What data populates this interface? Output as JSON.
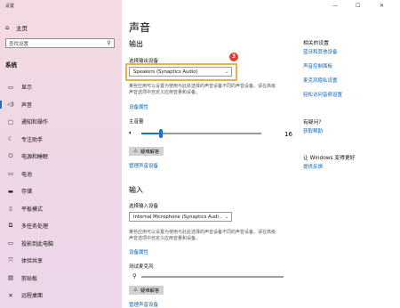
{
  "window": {
    "title": "设置",
    "minimize": "—",
    "maximize": "☐",
    "close": "✕"
  },
  "sidebar": {
    "home_label": "主页",
    "search_placeholder": "查找设置",
    "section_label": "系统",
    "items": [
      {
        "label": "显示",
        "icon": "monitor-icon",
        "glyph": "▭"
      },
      {
        "label": "声音",
        "icon": "speaker-icon",
        "glyph": "◁)",
        "selected": true
      },
      {
        "label": "通知和操作",
        "icon": "notification-icon",
        "glyph": "▢"
      },
      {
        "label": "专注助手",
        "icon": "moon-icon",
        "glyph": "☾"
      },
      {
        "label": "电源和睡眠",
        "icon": "power-icon",
        "glyph": "⏻"
      },
      {
        "label": "电池",
        "icon": "battery-icon",
        "glyph": "▭"
      },
      {
        "label": "存储",
        "icon": "storage-icon",
        "glyph": "▬"
      },
      {
        "label": "平板模式",
        "icon": "tablet-icon",
        "glyph": "▯"
      },
      {
        "label": "多任务处理",
        "icon": "multitask-icon",
        "glyph": "⧉"
      },
      {
        "label": "投影到此电脑",
        "icon": "project-icon",
        "glyph": "▭"
      },
      {
        "label": "体验共享",
        "icon": "share-icon",
        "glyph": "⤧"
      },
      {
        "label": "剪贴板",
        "icon": "clipboard-icon",
        "glyph": "▤"
      },
      {
        "label": "远程桌面",
        "icon": "remote-icon",
        "glyph": "✕"
      }
    ]
  },
  "main": {
    "title": "声音",
    "output": {
      "heading": "输出",
      "device_label": "选择输出设备",
      "device_value": "Speakers (Synaptics Audio)",
      "step_badge": "3",
      "description": "某些应用可以设置为使用与此处选择的声音设备不同的声音设备。请在高级声音选项中自定义应用音量和设备。",
      "properties_link": "设备属性",
      "volume_label": "主音量",
      "volume_value": "16",
      "volume_level": 0.16,
      "troubleshoot_label": "疑难解答",
      "manage_link": "管理声音设备"
    },
    "input": {
      "heading": "输入",
      "device_label": "选择输入设备",
      "device_value": "Internal Microphone (Synaptics Audi...",
      "description": "某些应用可以设置为使用与此处选择的声音设备不同的声音设备。请在高级声音选项中自定义应用音量和设备。",
      "properties_link": "设备属性",
      "test_label": "测试麦克风",
      "troubleshoot_label": "疑难解答",
      "manage_link": "管理声音设备"
    }
  },
  "related": {
    "heading": "相关的设置",
    "links": [
      "蓝牙和其他设备",
      "声音控制面板",
      "麦克风隐私设置",
      "轻松访问音频设置"
    ]
  },
  "help": {
    "heading": "有疑问?",
    "link": "获取帮助"
  },
  "feedback": {
    "heading": "让 Windows 变得更好",
    "link": "提供反馈"
  },
  "colors": {
    "accent": "#1a73c6",
    "highlight": "#e6b44a",
    "badge": "#e33b2c",
    "link": "#0a64b4"
  }
}
